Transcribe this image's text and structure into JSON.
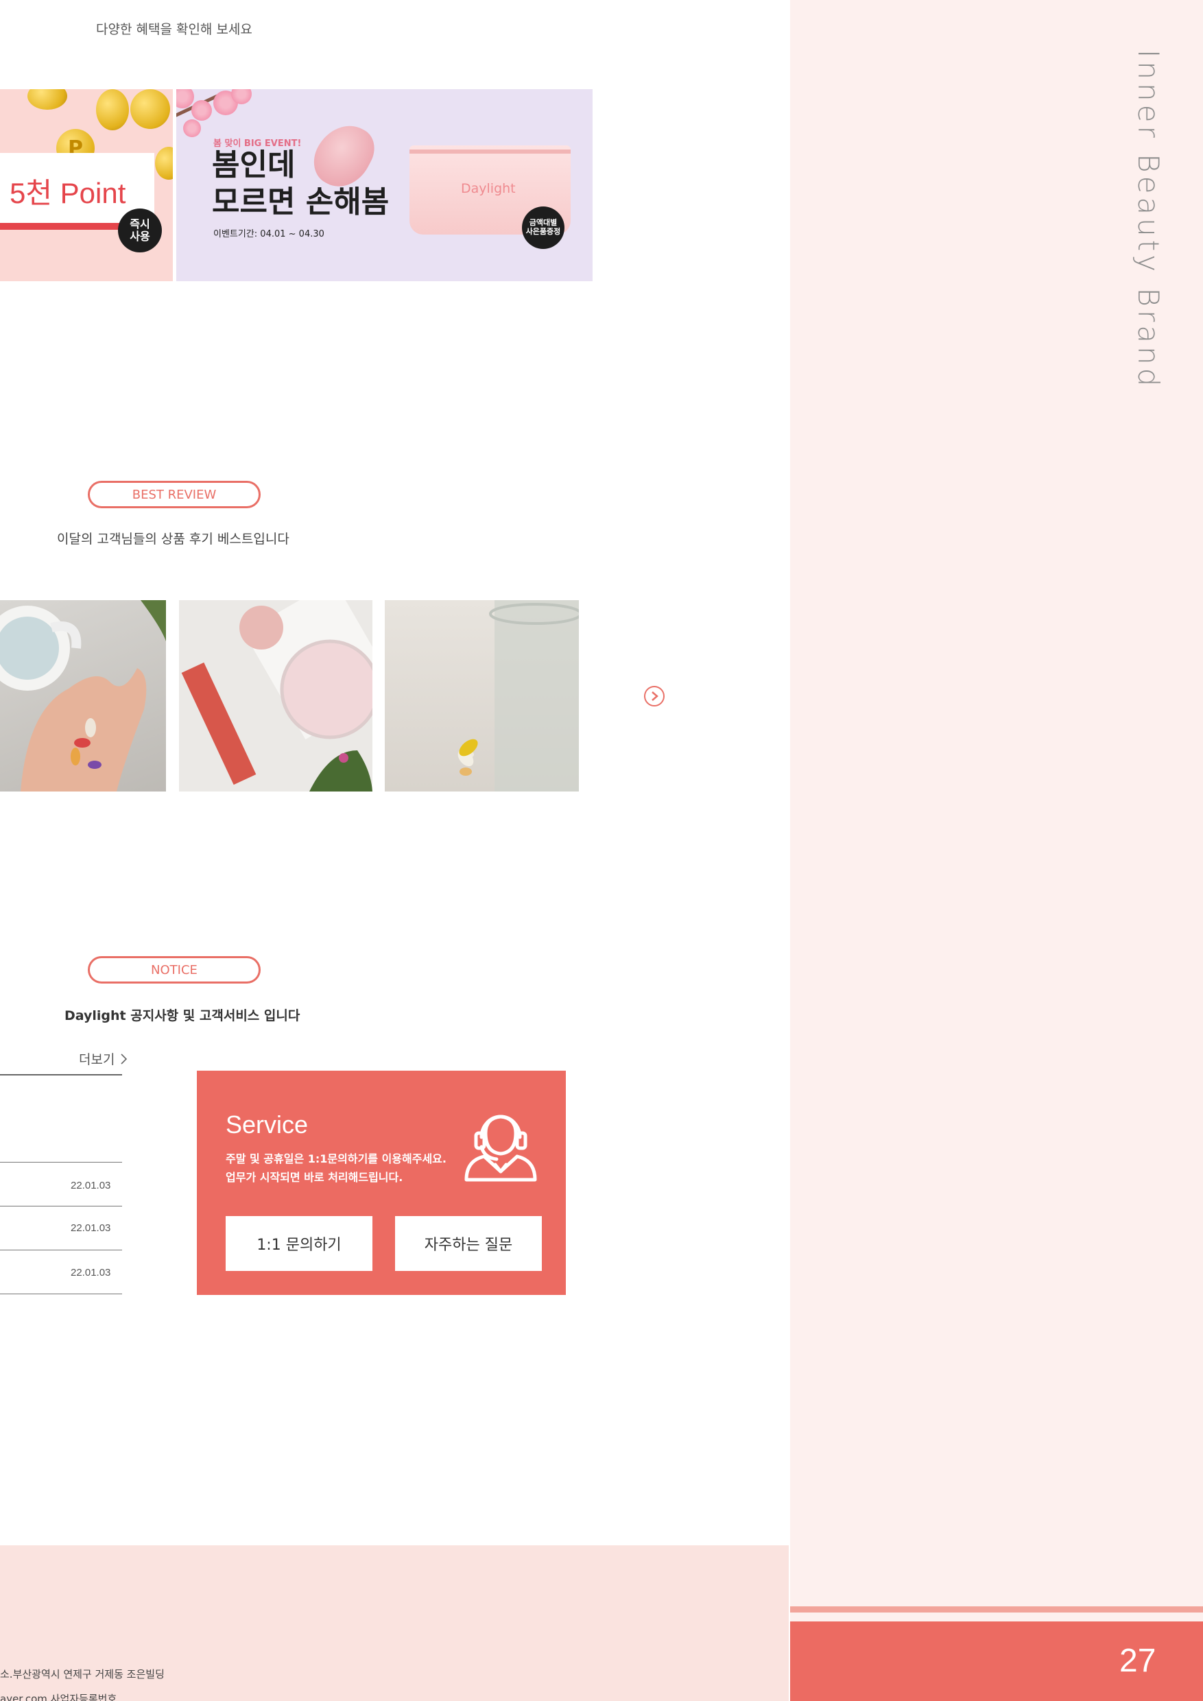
{
  "event_section": {
    "subtitle": "다양한 혜택을 확인해 보세요",
    "point_banner": {
      "coin_mark": "P",
      "title": "5천 Point",
      "badge": "즉시\n사용"
    },
    "spring_banner": {
      "tag": "봄 맞이 BIG EVENT!",
      "title_line1": "봄인데",
      "title_line2": "모르면 손해봄",
      "period": "이벤트기간: 04.01 ~ 04.30",
      "product_logo": "Daylight",
      "badge": "금액대별\n사은품증정"
    }
  },
  "review_section": {
    "label": "BEST REVIEW",
    "subtitle": "이달의 고객님들의 상품 후기 베스트입니다",
    "photos": [
      "hand-holding-pills",
      "collagen-stick-powder",
      "water-glass-capsules"
    ]
  },
  "notice_section": {
    "label": "NOTICE",
    "subtitle": "Daylight 공지사항 및 고객서비스 입니다",
    "more": "더보기",
    "dates": [
      "22.01.03",
      "22.01.03",
      "22.01.03"
    ]
  },
  "service": {
    "title": "Service",
    "line1": "주말 및 공휴일은 1:1문의하기를 이용해주세요.",
    "line2": "업무가 시작되면 바로 처리해드립니다.",
    "btn_inquiry": "1:1 문의하기",
    "btn_faq": "자주하는 질문"
  },
  "footer": {
    "address": "소.부산광역시 연제구 거제동 조은빌딩",
    "contact": "ayer.com    사업자등록번호"
  },
  "sidebar": {
    "brand": "Inner Beauty Brand",
    "page_number": "27"
  },
  "colors": {
    "accent": "#ec6b62",
    "sidebar_bg": "#fdf0ee",
    "footer_bg": "#fae3df"
  }
}
